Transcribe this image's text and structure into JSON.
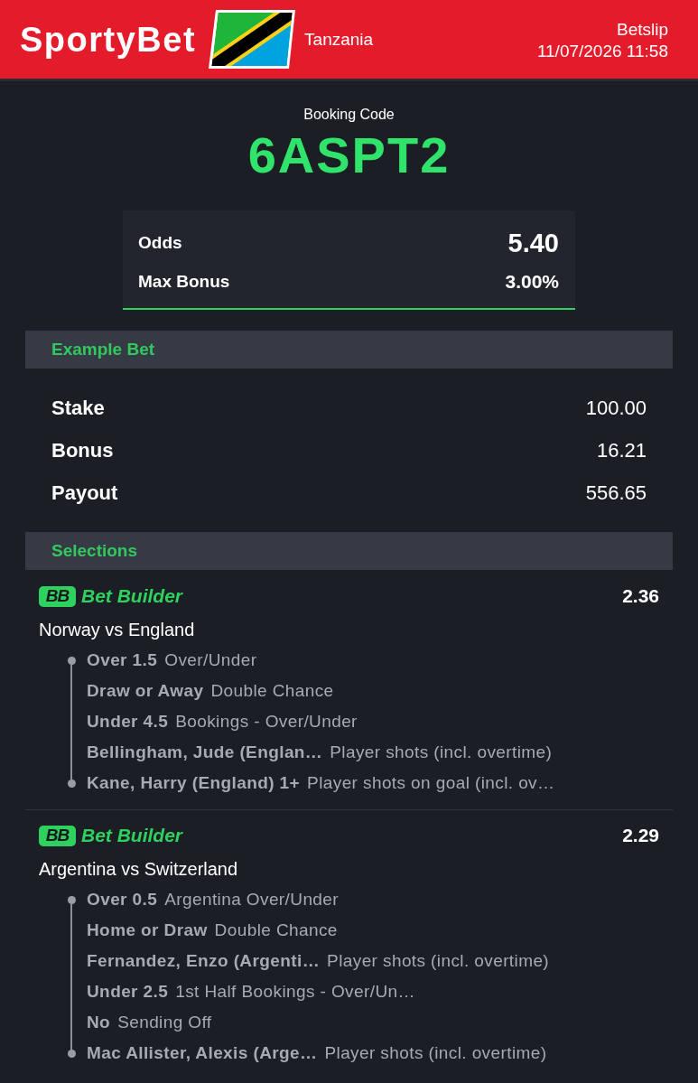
{
  "header": {
    "logo": "SportyBet",
    "country": "Tanzania",
    "title": "Betslip",
    "datetime": "11/07/2026 11:58"
  },
  "booking": {
    "label": "Booking Code",
    "code": "6ASPT2"
  },
  "summary": [
    {
      "label": "Odds",
      "value": "5.40"
    },
    {
      "label": "Max Bonus",
      "value": "3.00%"
    }
  ],
  "example_bet": {
    "title": "Example Bet",
    "rows": [
      {
        "label": "Stake",
        "value": "100.00"
      },
      {
        "label": "Bonus",
        "value": "16.21"
      },
      {
        "label": "Payout",
        "value": "556.65"
      }
    ]
  },
  "selections": {
    "title": "Selections",
    "bets": [
      {
        "badge": "BB",
        "type": "Bet Builder",
        "odds": "2.36",
        "match": "Norway vs England",
        "legs": [
          {
            "pick": "Over 1.5",
            "market": "Over/Under"
          },
          {
            "pick": "Draw or Away",
            "market": "Double Chance"
          },
          {
            "pick": "Under 4.5",
            "market": "Bookings - Over/Under"
          },
          {
            "pick": "Bellingham, Jude (Englan…",
            "market": "Player shots (incl. overtime)"
          },
          {
            "pick": "Kane, Harry (England) 1+",
            "market": "Player shots on goal (incl. ov…"
          }
        ]
      },
      {
        "badge": "BB",
        "type": "Bet Builder",
        "odds": "2.29",
        "match": "Argentina vs Switzerland",
        "legs": [
          {
            "pick": "Over 0.5",
            "market": "Argentina Over/Under"
          },
          {
            "pick": "Home or Draw",
            "market": "Double Chance"
          },
          {
            "pick": "Fernandez, Enzo (Argenti…",
            "market": "Player shots (incl. overtime)"
          },
          {
            "pick": "Under 2.5",
            "market": "1st Half Bookings - Over/Un…"
          },
          {
            "pick": "No",
            "market": "Sending Off"
          },
          {
            "pick": "Mac Allister, Alexis (Arge…",
            "market": "Player shots (incl. overtime)"
          }
        ]
      }
    ]
  }
}
